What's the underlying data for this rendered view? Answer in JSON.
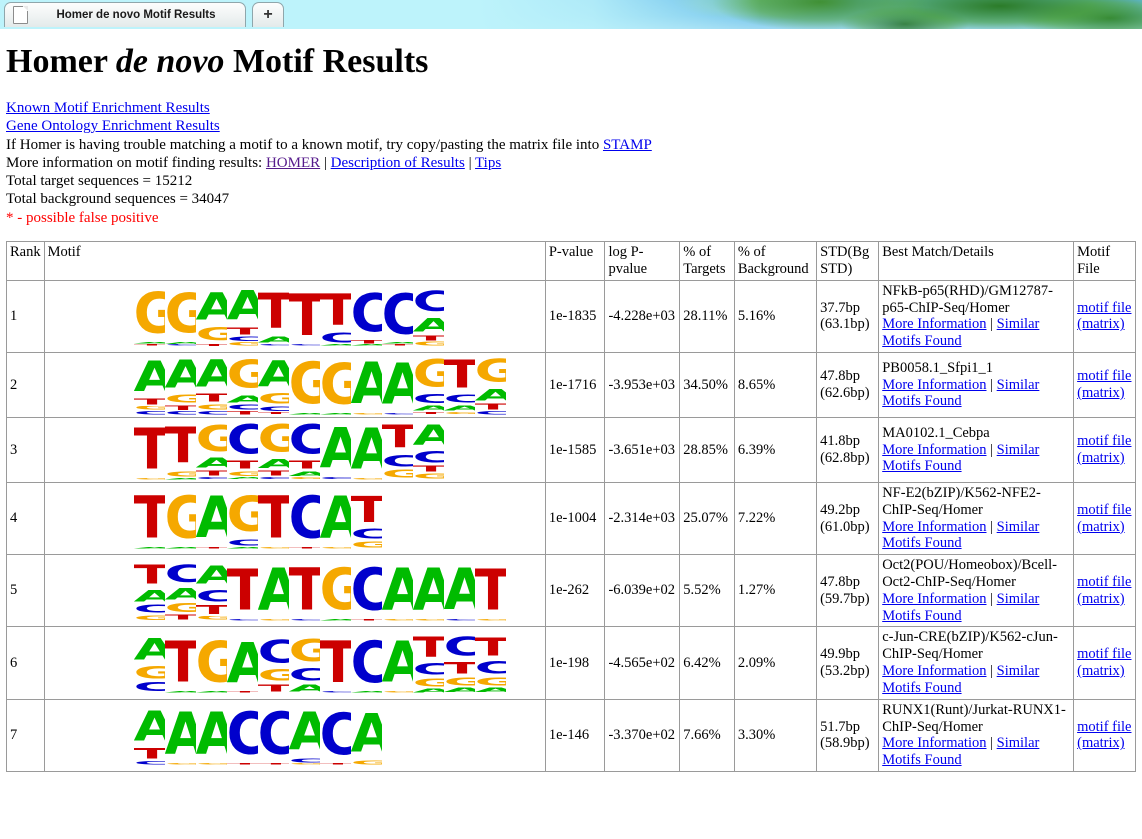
{
  "browser": {
    "tab_title": "Homer de novo Motif Results",
    "new_tab_label": "+",
    "favicon": "page-icon"
  },
  "header": {
    "title_part1": "Homer ",
    "title_italic": "de novo",
    "title_part2": " Motif Results"
  },
  "intro": {
    "known_motif_link": "Known Motif Enrichment Results",
    "gene_ontology_link": "Gene Ontology Enrichment Results",
    "stamp_text_before": "If Homer is having trouble matching a motif to a known motif, try copy/pasting the matrix file into ",
    "stamp_link": "STAMP",
    "more_info_prefix": "More information on motif finding results: ",
    "homer_link": "HOMER",
    "sep1": " | ",
    "description_link": "Description of Results",
    "sep2": " | ",
    "tips_link": "Tips",
    "total_target": "Total target sequences = 15212",
    "total_background": "Total background sequences = 34047",
    "false_positive_note": "* - possible false positive"
  },
  "table": {
    "headers": {
      "rank": "Rank",
      "motif": "Motif",
      "pvalue": "P-value",
      "logpvalue": "log P-pvalue",
      "pct_targets": "% of Targets",
      "pct_background": "% of Background",
      "std": "STD(Bg STD)",
      "best_match": "Best Match/Details",
      "motif_file": "Motif File"
    },
    "link_labels": {
      "more_information": "More Information",
      "separator": " | ",
      "similar_motifs": "Similar Motifs Found",
      "motif_file": "motif file (matrix)"
    },
    "rows": [
      {
        "rank": "1",
        "pvalue": "1e-1835",
        "logpvalue": "-4.228e+03",
        "pct_targets": "28.11%",
        "pct_background": "5.16%",
        "std": "37.7bp (63.1bp)",
        "best_match": "NFkB-p65(RHD)/GM12787-p65-ChIP-Seq/Homer",
        "consensus": "GGAATTTCCC"
      },
      {
        "rank": "2",
        "pvalue": "1e-1716",
        "logpvalue": "-3.953e+03",
        "pct_targets": "34.50%",
        "pct_background": "8.65%",
        "std": "47.8bp (62.6bp)",
        "best_match": "PB0058.1_Sfpi1_1",
        "consensus": "AAAGAGGAAGTG"
      },
      {
        "rank": "3",
        "pvalue": "1e-1585",
        "logpvalue": "-3.651e+03",
        "pct_targets": "28.85%",
        "pct_background": "6.39%",
        "std": "41.8bp (62.8bp)",
        "best_match": "MA0102.1_Cebpa",
        "consensus": "TTGCGCAATA"
      },
      {
        "rank": "4",
        "pvalue": "1e-1004",
        "logpvalue": "-2.314e+03",
        "pct_targets": "25.07%",
        "pct_background": "7.22%",
        "std": "49.2bp (61.0bp)",
        "best_match": "NF-E2(bZIP)/K562-NFE2-ChIP-Seq/Homer",
        "consensus": "TGAGTCAT"
      },
      {
        "rank": "5",
        "pvalue": "1e-262",
        "logpvalue": "-6.039e+02",
        "pct_targets": "5.52%",
        "pct_background": "1.27%",
        "std": "47.8bp (59.7bp)",
        "best_match": "Oct2(POU/Homeobox)/Bcell-Oct2-ChIP-Seq/Homer",
        "consensus": "TATATGCAAAT"
      },
      {
        "rank": "6",
        "pvalue": "1e-198",
        "logpvalue": "-4.565e+02",
        "pct_targets": "6.42%",
        "pct_background": "2.09%",
        "std": "49.9bp (53.2bp)",
        "best_match": "c-Jun-CRE(bZIP)/K562-cJun-ChIP-Seq/Homer",
        "consensus": "ATGACGTCATCTC"
      },
      {
        "rank": "7",
        "pvalue": "1e-146",
        "logpvalue": "-3.370e+02",
        "pct_targets": "7.66%",
        "pct_background": "3.30%",
        "std": "51.7bp (58.9bp)",
        "best_match": "RUNX1(Runt)/Jurkat-RUNX1-ChIP-Seq/Homer",
        "consensus": "AAACCACA"
      }
    ]
  },
  "logos": {
    "colors": {
      "A": "#00bb00",
      "C": "#0000cc",
      "G": "#f5a800",
      "T": "#cc0000"
    },
    "motifs": [
      [
        [
          [
            "G",
            0.93
          ],
          [
            "A",
            0.04
          ],
          [
            "T",
            0.02
          ]
        ],
        [
          [
            "G",
            0.9
          ],
          [
            "A",
            0.05
          ],
          [
            "C",
            0.03
          ]
        ],
        [
          [
            "A",
            0.62
          ],
          [
            "G",
            0.3
          ],
          [
            "T",
            0.05
          ]
        ],
        [
          [
            "A",
            0.66
          ],
          [
            "T",
            0.16
          ],
          [
            "C",
            0.1
          ],
          [
            "G",
            0.06
          ]
        ],
        [
          [
            "T",
            0.8
          ],
          [
            "A",
            0.14
          ],
          [
            "C",
            0.04
          ]
        ],
        [
          [
            "T",
            0.95
          ],
          [
            "C",
            0.03
          ]
        ],
        [
          [
            "T",
            0.72
          ],
          [
            "C",
            0.22
          ],
          [
            "A",
            0.04
          ]
        ],
        [
          [
            "C",
            0.88
          ],
          [
            "T",
            0.06
          ],
          [
            "A",
            0.04
          ]
        ],
        [
          [
            "C",
            0.92
          ],
          [
            "A",
            0.04
          ],
          [
            "T",
            0.03
          ]
        ],
        [
          [
            "C",
            0.46
          ],
          [
            "A",
            0.32
          ],
          [
            "T",
            0.12
          ],
          [
            "G",
            0.08
          ]
        ]
      ],
      [
        [
          [
            "A",
            0.7
          ],
          [
            "T",
            0.14
          ],
          [
            "G",
            0.09
          ],
          [
            "C",
            0.06
          ]
        ],
        [
          [
            "A",
            0.64
          ],
          [
            "G",
            0.18
          ],
          [
            "T",
            0.1
          ],
          [
            "C",
            0.07
          ]
        ],
        [
          [
            "A",
            0.62
          ],
          [
            "T",
            0.18
          ],
          [
            "G",
            0.12
          ],
          [
            "C",
            0.07
          ]
        ],
        [
          [
            "G",
            0.64
          ],
          [
            "A",
            0.17
          ],
          [
            "C",
            0.11
          ],
          [
            "T",
            0.07
          ]
        ],
        [
          [
            "A",
            0.6
          ],
          [
            "G",
            0.24
          ],
          [
            "C",
            0.1
          ],
          [
            "T",
            0.05
          ]
        ],
        [
          [
            "G",
            0.95
          ],
          [
            "A",
            0.03
          ]
        ],
        [
          [
            "G",
            0.94
          ],
          [
            "A",
            0.04
          ]
        ],
        [
          [
            "A",
            0.95
          ],
          [
            "G",
            0.03
          ]
        ],
        [
          [
            "A",
            0.93
          ],
          [
            "C",
            0.04
          ]
        ],
        [
          [
            "G",
            0.62
          ],
          [
            "C",
            0.2
          ],
          [
            "A",
            0.12
          ],
          [
            "T",
            0.05
          ]
        ],
        [
          [
            "T",
            0.64
          ],
          [
            "C",
            0.18
          ],
          [
            "A",
            0.12
          ],
          [
            "G",
            0.05
          ]
        ],
        [
          [
            "G",
            0.52
          ],
          [
            "A",
            0.26
          ],
          [
            "T",
            0.14
          ],
          [
            "C",
            0.07
          ]
        ]
      ],
      [
        [
          [
            "T",
            0.94
          ],
          [
            "G",
            0.04
          ]
        ],
        [
          [
            "T",
            0.82
          ],
          [
            "G",
            0.12
          ],
          [
            "A",
            0.04
          ]
        ],
        [
          [
            "G",
            0.6
          ],
          [
            "A",
            0.22
          ],
          [
            "T",
            0.12
          ],
          [
            "C",
            0.05
          ]
        ],
        [
          [
            "C",
            0.66
          ],
          [
            "T",
            0.18
          ],
          [
            "G",
            0.1
          ],
          [
            "A",
            0.05
          ]
        ],
        [
          [
            "G",
            0.62
          ],
          [
            "A",
            0.2
          ],
          [
            "T",
            0.12
          ],
          [
            "C",
            0.05
          ]
        ],
        [
          [
            "C",
            0.66
          ],
          [
            "T",
            0.18
          ],
          [
            "A",
            0.1
          ],
          [
            "G",
            0.05
          ]
        ],
        [
          [
            "A",
            0.92
          ],
          [
            "C",
            0.05
          ]
        ],
        [
          [
            "A",
            0.94
          ],
          [
            "G",
            0.04
          ]
        ],
        [
          [
            "T",
            0.52
          ],
          [
            "C",
            0.26
          ],
          [
            "G",
            0.18
          ]
        ],
        [
          [
            "A",
            0.46
          ],
          [
            "C",
            0.26
          ],
          [
            "T",
            0.14
          ],
          [
            "G",
            0.12
          ]
        ]
      ],
      [
        [
          [
            "T",
            0.97
          ],
          [
            "A",
            0.02
          ]
        ],
        [
          [
            "G",
            0.96
          ],
          [
            "A",
            0.02
          ]
        ],
        [
          [
            "A",
            0.95
          ],
          [
            "T",
            0.03
          ]
        ],
        [
          [
            "G",
            0.8
          ],
          [
            "C",
            0.14
          ],
          [
            "A",
            0.04
          ]
        ],
        [
          [
            "T",
            0.96
          ],
          [
            "G",
            0.02
          ]
        ],
        [
          [
            "C",
            0.97
          ],
          [
            "T",
            0.02
          ]
        ],
        [
          [
            "A",
            0.96
          ],
          [
            "G",
            0.02
          ]
        ],
        [
          [
            "T",
            0.6
          ],
          [
            "C",
            0.22
          ],
          [
            "G",
            0.14
          ]
        ]
      ],
      [
        [
          [
            "T",
            0.44
          ],
          [
            "A",
            0.26
          ],
          [
            "C",
            0.18
          ],
          [
            "G",
            0.1
          ]
        ],
        [
          [
            "C",
            0.4
          ],
          [
            "A",
            0.26
          ],
          [
            "G",
            0.2
          ],
          [
            "T",
            0.12
          ]
        ],
        [
          [
            "A",
            0.42
          ],
          [
            "C",
            0.26
          ],
          [
            "T",
            0.2
          ],
          [
            "G",
            0.08
          ]
        ],
        [
          [
            "T",
            0.94
          ],
          [
            "C",
            0.03
          ]
        ],
        [
          [
            "A",
            0.96
          ],
          [
            "G",
            0.02
          ]
        ],
        [
          [
            "T",
            0.96
          ],
          [
            "C",
            0.02
          ]
        ],
        [
          [
            "G",
            0.95
          ],
          [
            "A",
            0.03
          ]
        ],
        [
          [
            "C",
            0.96
          ],
          [
            "T",
            0.02
          ]
        ],
        [
          [
            "A",
            0.97
          ],
          [
            "G",
            0.02
          ]
        ],
        [
          [
            "A",
            0.96
          ],
          [
            "G",
            0.02
          ]
        ],
        [
          [
            "A",
            0.95
          ],
          [
            "C",
            0.03
          ]
        ],
        [
          [
            "T",
            0.94
          ],
          [
            "G",
            0.03
          ]
        ]
      ],
      [
        [
          [
            "A",
            0.48
          ],
          [
            "G",
            0.28
          ],
          [
            "C",
            0.2
          ]
        ],
        [
          [
            "T",
            0.94
          ],
          [
            "A",
            0.03
          ]
        ],
        [
          [
            "G",
            0.94
          ],
          [
            "A",
            0.03
          ]
        ],
        [
          [
            "A",
            0.92
          ],
          [
            "T",
            0.04
          ]
        ],
        [
          [
            "C",
            0.52
          ],
          [
            "G",
            0.26
          ],
          [
            "T",
            0.16
          ]
        ],
        [
          [
            "G",
            0.5
          ],
          [
            "C",
            0.28
          ],
          [
            "A",
            0.16
          ]
        ],
        [
          [
            "T",
            0.95
          ],
          [
            "C",
            0.03
          ]
        ],
        [
          [
            "C",
            0.95
          ],
          [
            "A",
            0.03
          ]
        ],
        [
          [
            "A",
            0.94
          ],
          [
            "G",
            0.03
          ]
        ],
        [
          [
            "T",
            0.46
          ],
          [
            "C",
            0.26
          ],
          [
            "G",
            0.18
          ],
          [
            "A",
            0.08
          ]
        ],
        [
          [
            "C",
            0.44
          ],
          [
            "T",
            0.26
          ],
          [
            "G",
            0.18
          ],
          [
            "A",
            0.1
          ]
        ],
        [
          [
            "T",
            0.42
          ],
          [
            "C",
            0.28
          ],
          [
            "G",
            0.18
          ],
          [
            "A",
            0.1
          ]
        ]
      ],
      [
        [
          [
            "A",
            0.68
          ],
          [
            "T",
            0.24
          ],
          [
            "C",
            0.06
          ]
        ],
        [
          [
            "A",
            0.96
          ],
          [
            "G",
            0.02
          ]
        ],
        [
          [
            "A",
            0.96
          ],
          [
            "G",
            0.02
          ]
        ],
        [
          [
            "C",
            0.97
          ],
          [
            "T",
            0.02
          ]
        ],
        [
          [
            "C",
            0.97
          ],
          [
            "T",
            0.02
          ]
        ],
        [
          [
            "A",
            0.86
          ],
          [
            "C",
            0.08
          ],
          [
            "G",
            0.04
          ]
        ],
        [
          [
            "C",
            0.95
          ],
          [
            "T",
            0.03
          ]
        ],
        [
          [
            "A",
            0.88
          ],
          [
            "G",
            0.08
          ]
        ]
      ]
    ]
  }
}
